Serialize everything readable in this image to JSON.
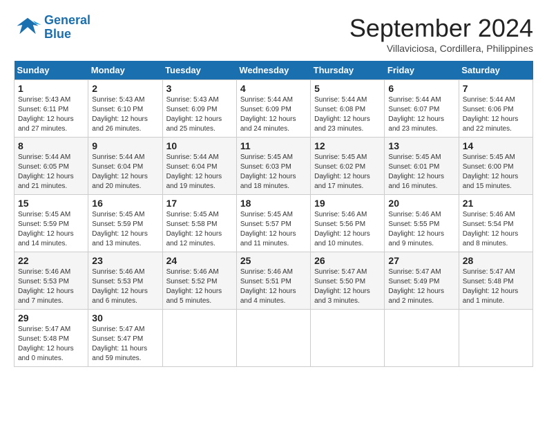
{
  "header": {
    "logo_line1": "General",
    "logo_line2": "Blue",
    "month_title": "September 2024",
    "location": "Villaviciosa, Cordillera, Philippines"
  },
  "columns": [
    "Sunday",
    "Monday",
    "Tuesday",
    "Wednesday",
    "Thursday",
    "Friday",
    "Saturday"
  ],
  "weeks": [
    [
      {
        "num": "1",
        "info": "Sunrise: 5:43 AM\nSunset: 6:11 PM\nDaylight: 12 hours\nand 27 minutes."
      },
      {
        "num": "2",
        "info": "Sunrise: 5:43 AM\nSunset: 6:10 PM\nDaylight: 12 hours\nand 26 minutes."
      },
      {
        "num": "3",
        "info": "Sunrise: 5:43 AM\nSunset: 6:09 PM\nDaylight: 12 hours\nand 25 minutes."
      },
      {
        "num": "4",
        "info": "Sunrise: 5:44 AM\nSunset: 6:09 PM\nDaylight: 12 hours\nand 24 minutes."
      },
      {
        "num": "5",
        "info": "Sunrise: 5:44 AM\nSunset: 6:08 PM\nDaylight: 12 hours\nand 23 minutes."
      },
      {
        "num": "6",
        "info": "Sunrise: 5:44 AM\nSunset: 6:07 PM\nDaylight: 12 hours\nand 23 minutes."
      },
      {
        "num": "7",
        "info": "Sunrise: 5:44 AM\nSunset: 6:06 PM\nDaylight: 12 hours\nand 22 minutes."
      }
    ],
    [
      {
        "num": "8",
        "info": "Sunrise: 5:44 AM\nSunset: 6:05 PM\nDaylight: 12 hours\nand 21 minutes."
      },
      {
        "num": "9",
        "info": "Sunrise: 5:44 AM\nSunset: 6:04 PM\nDaylight: 12 hours\nand 20 minutes."
      },
      {
        "num": "10",
        "info": "Sunrise: 5:44 AM\nSunset: 6:04 PM\nDaylight: 12 hours\nand 19 minutes."
      },
      {
        "num": "11",
        "info": "Sunrise: 5:45 AM\nSunset: 6:03 PM\nDaylight: 12 hours\nand 18 minutes."
      },
      {
        "num": "12",
        "info": "Sunrise: 5:45 AM\nSunset: 6:02 PM\nDaylight: 12 hours\nand 17 minutes."
      },
      {
        "num": "13",
        "info": "Sunrise: 5:45 AM\nSunset: 6:01 PM\nDaylight: 12 hours\nand 16 minutes."
      },
      {
        "num": "14",
        "info": "Sunrise: 5:45 AM\nSunset: 6:00 PM\nDaylight: 12 hours\nand 15 minutes."
      }
    ],
    [
      {
        "num": "15",
        "info": "Sunrise: 5:45 AM\nSunset: 5:59 PM\nDaylight: 12 hours\nand 14 minutes."
      },
      {
        "num": "16",
        "info": "Sunrise: 5:45 AM\nSunset: 5:59 PM\nDaylight: 12 hours\nand 13 minutes."
      },
      {
        "num": "17",
        "info": "Sunrise: 5:45 AM\nSunset: 5:58 PM\nDaylight: 12 hours\nand 12 minutes."
      },
      {
        "num": "18",
        "info": "Sunrise: 5:45 AM\nSunset: 5:57 PM\nDaylight: 12 hours\nand 11 minutes."
      },
      {
        "num": "19",
        "info": "Sunrise: 5:46 AM\nSunset: 5:56 PM\nDaylight: 12 hours\nand 10 minutes."
      },
      {
        "num": "20",
        "info": "Sunrise: 5:46 AM\nSunset: 5:55 PM\nDaylight: 12 hours\nand 9 minutes."
      },
      {
        "num": "21",
        "info": "Sunrise: 5:46 AM\nSunset: 5:54 PM\nDaylight: 12 hours\nand 8 minutes."
      }
    ],
    [
      {
        "num": "22",
        "info": "Sunrise: 5:46 AM\nSunset: 5:53 PM\nDaylight: 12 hours\nand 7 minutes."
      },
      {
        "num": "23",
        "info": "Sunrise: 5:46 AM\nSunset: 5:53 PM\nDaylight: 12 hours\nand 6 minutes."
      },
      {
        "num": "24",
        "info": "Sunrise: 5:46 AM\nSunset: 5:52 PM\nDaylight: 12 hours\nand 5 minutes."
      },
      {
        "num": "25",
        "info": "Sunrise: 5:46 AM\nSunset: 5:51 PM\nDaylight: 12 hours\nand 4 minutes."
      },
      {
        "num": "26",
        "info": "Sunrise: 5:47 AM\nSunset: 5:50 PM\nDaylight: 12 hours\nand 3 minutes."
      },
      {
        "num": "27",
        "info": "Sunrise: 5:47 AM\nSunset: 5:49 PM\nDaylight: 12 hours\nand 2 minutes."
      },
      {
        "num": "28",
        "info": "Sunrise: 5:47 AM\nSunset: 5:48 PM\nDaylight: 12 hours\nand 1 minute."
      }
    ],
    [
      {
        "num": "29",
        "info": "Sunrise: 5:47 AM\nSunset: 5:48 PM\nDaylight: 12 hours\nand 0 minutes."
      },
      {
        "num": "30",
        "info": "Sunrise: 5:47 AM\nSunset: 5:47 PM\nDaylight: 11 hours\nand 59 minutes."
      },
      null,
      null,
      null,
      null,
      null
    ]
  ]
}
